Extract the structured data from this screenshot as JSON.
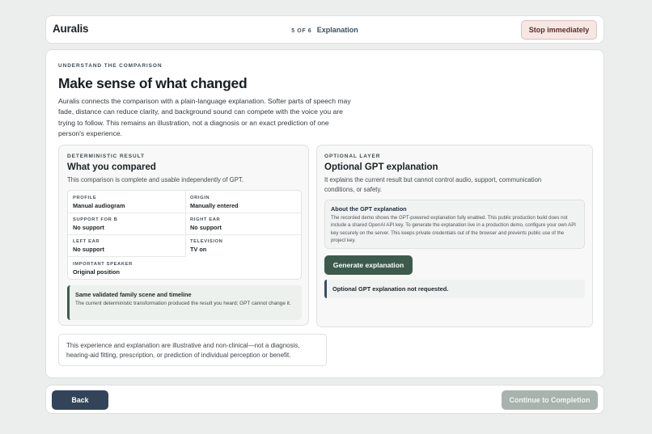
{
  "header": {
    "brand": "Auralis",
    "step_count": "5 OF 6",
    "step_name": "Explanation",
    "stop_label": "Stop immediately"
  },
  "main": {
    "eyebrow": "UNDERSTAND THE COMPARISON",
    "title": "Make sense of what changed",
    "intro": "Auralis connects the comparison with a plain-language explanation. Softer parts of speech may fade, distance can reduce clarity, and background sound can compete with the voice you are trying to follow. This remains an illustration, not a diagnosis or an exact prediction of one person's experience."
  },
  "deterministic": {
    "eyebrow": "DETERMINISTIC RESULT",
    "title": "What you compared",
    "desc": "This comparison is complete and usable independently of GPT.",
    "fields": [
      {
        "label": "PROFILE",
        "value": "Manual audiogram"
      },
      {
        "label": "ORIGIN",
        "value": "Manually entered"
      },
      {
        "label": "SUPPORT FOR B",
        "value": "No support"
      },
      {
        "label": "RIGHT EAR",
        "value": "No support"
      },
      {
        "label": "LEFT EAR",
        "value": "No support"
      },
      {
        "label": "TELEVISION",
        "value": "TV on"
      },
      {
        "label": "IMPORTANT SPEAKER",
        "value": "Original position"
      }
    ],
    "notice_title": "Same validated family scene and timeline",
    "notice_body": "The current deterministic transformation produced the result you heard; GPT cannot change it."
  },
  "optional": {
    "eyebrow": "OPTIONAL LAYER",
    "title": "Optional GPT explanation",
    "desc": "It explains the current result but cannot control audio, support, communication conditions, or safety.",
    "about_title": "About the GPT explanation",
    "about_body": "The recorded demo shows the GPT-powered explanation fully enabled. This public production build does not include a shared OpenAI API key. To generate the explanation live in a production demo, configure your own API key securely on the server. This keeps private credentials out of the browser and prevents public use of the project key.",
    "generate_label": "Generate explanation",
    "status": "Optional GPT explanation not requested."
  },
  "disclaimer": "This experience and explanation are illustrative and non-clinical—not a diagnosis, hearing-aid fitting, prescription, or prediction of individual perception or benefit.",
  "footer": {
    "back_label": "Back",
    "continue_label": "Continue to Completion"
  },
  "colors": {
    "primary_green": "#3c5b4d",
    "back_navy": "#334459",
    "stop_bg": "#f6e6e4",
    "continue_disabled": "#a8b3ae"
  }
}
